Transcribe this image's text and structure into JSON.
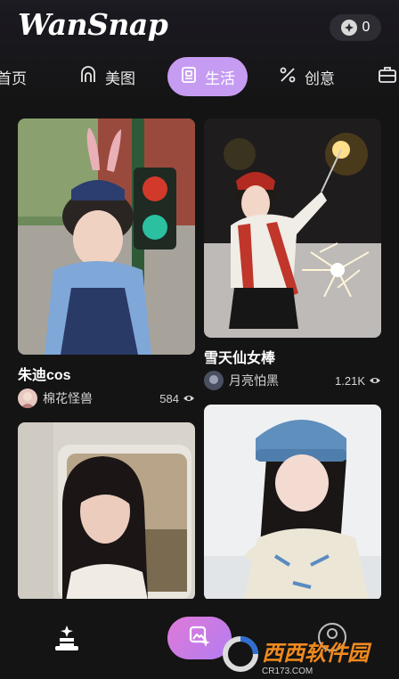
{
  "header": {
    "app_title": "WanSnap",
    "coin_count": "0"
  },
  "tabs": [
    {
      "label": "首页",
      "icon": "home-icon"
    },
    {
      "label": "美图",
      "icon": "beauty-icon"
    },
    {
      "label": "生活",
      "icon": "life-icon",
      "active": true
    },
    {
      "label": "创意",
      "icon": "creative-icon"
    },
    {
      "label": "",
      "icon": "briefcase-icon"
    }
  ],
  "feed": {
    "left": [
      {
        "title": "朱迪cos",
        "author": "棉花怪兽",
        "views": "584",
        "image": "girl-bunny-ears-traffic-light"
      },
      {
        "title": "",
        "author": "",
        "views": "",
        "image": "girl-train-window"
      }
    ],
    "right": [
      {
        "title": "雪天仙女棒",
        "author": "月亮怕黑",
        "views": "1.21K",
        "image": "girl-sparkler-snow"
      },
      {
        "title": "",
        "author": "",
        "views": "",
        "image": "girl-knit-hat-snow"
      }
    ]
  },
  "bottom_nav": {
    "items": [
      "magic-hat-icon",
      "create-image-icon",
      "profile-icon"
    ]
  },
  "watermark": {
    "brand": "西西软件园",
    "url": "CR173.COM"
  },
  "colors": {
    "background": "#141414",
    "accent": "#c69cf2",
    "create_gradient_start": "#e07ad8",
    "create_gradient_end": "#b27cf0"
  }
}
